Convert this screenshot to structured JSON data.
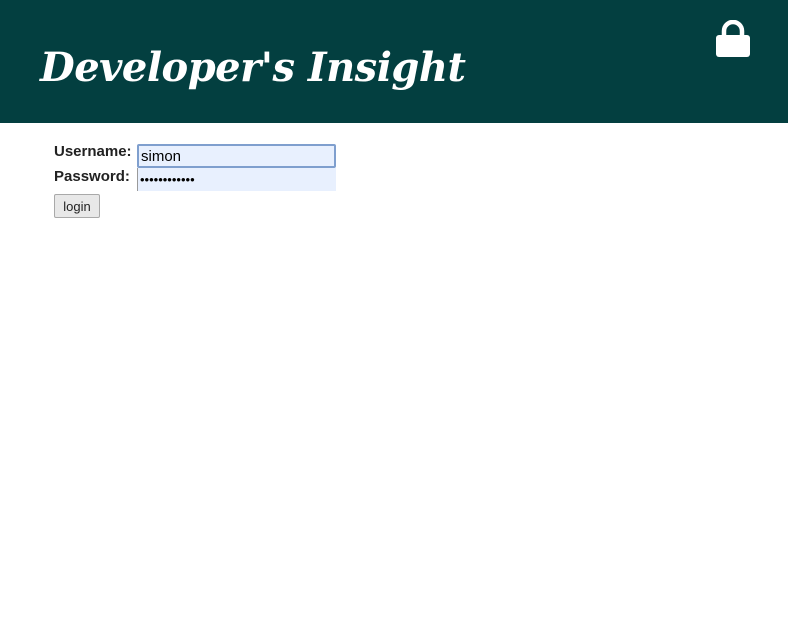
{
  "header": {
    "title": "Developer's Insight",
    "lock_icon": "lock-icon",
    "background_color": "#033f40"
  },
  "login_form": {
    "username_label": "Username:",
    "username_value": "simon",
    "password_label": "Password:",
    "password_value": "simon1234567",
    "submit_label": "login"
  }
}
